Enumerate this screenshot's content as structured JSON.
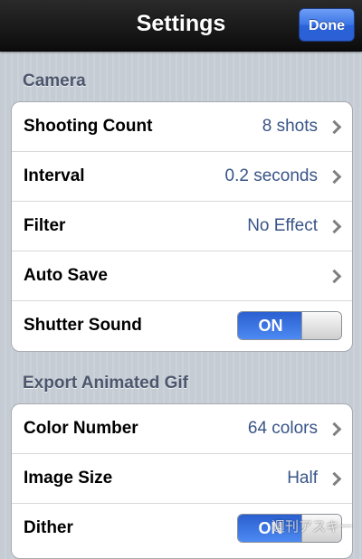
{
  "navbar": {
    "title": "Settings",
    "done_label": "Done"
  },
  "sections": {
    "camera": {
      "header": "Camera",
      "shooting_count": {
        "label": "Shooting Count",
        "value": "8 shots"
      },
      "interval": {
        "label": "Interval",
        "value": "0.2 seconds"
      },
      "filter": {
        "label": "Filter",
        "value": "No Effect"
      },
      "auto_save": {
        "label": "Auto Save"
      },
      "shutter_sound": {
        "label": "Shutter Sound",
        "toggle": "ON"
      }
    },
    "export": {
      "header": "Export Animated Gif",
      "color_number": {
        "label": "Color Number",
        "value": "64 colors"
      },
      "image_size": {
        "label": "Image Size",
        "value": "Half"
      },
      "dither": {
        "label": "Dither",
        "toggle": "ON"
      }
    }
  },
  "watermark": "週刊アスキー",
  "colors": {
    "accent": "#3a74e6",
    "value_text": "#385487",
    "section_header": "#4c566c",
    "navbar": "#111111"
  },
  "icons": {
    "disclosure": "chevron-right-icon"
  }
}
